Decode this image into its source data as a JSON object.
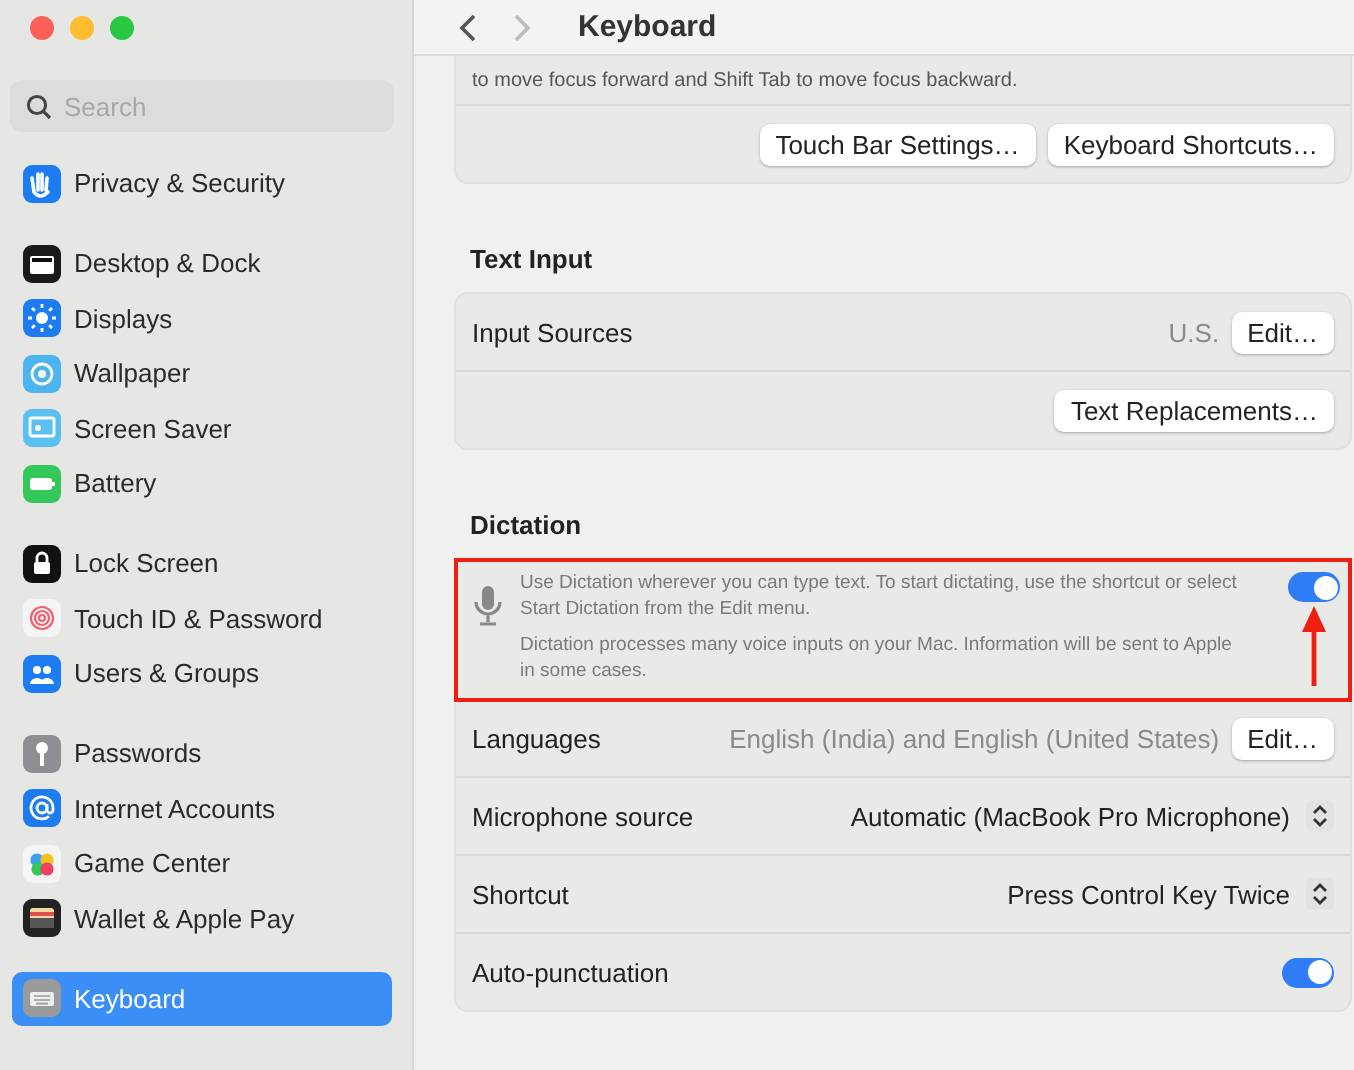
{
  "sidebar": {
    "search": {
      "placeholder": "Search"
    },
    "groups": [
      [
        {
          "label": "Privacy & Security",
          "selected": false
        }
      ],
      [
        {
          "label": "Desktop & Dock",
          "selected": false
        },
        {
          "label": "Displays",
          "selected": false
        },
        {
          "label": "Wallpaper",
          "selected": false
        },
        {
          "label": "Screen Saver",
          "selected": false
        },
        {
          "label": "Battery",
          "selected": false
        }
      ],
      [
        {
          "label": "Lock Screen",
          "selected": false
        },
        {
          "label": "Touch ID & Password",
          "selected": false
        },
        {
          "label": "Users & Groups",
          "selected": false
        }
      ],
      [
        {
          "label": "Passwords",
          "selected": false
        },
        {
          "label": "Internet Accounts",
          "selected": false
        },
        {
          "label": "Game Center",
          "selected": false
        },
        {
          "label": "Wallet & Apple Pay",
          "selected": false
        }
      ],
      [
        {
          "label": "Keyboard",
          "selected": true
        }
      ]
    ]
  },
  "content": {
    "title": "Keyboard",
    "top_card": {
      "text": "to move focus forward and Shift Tab to move focus backward.",
      "buttons": [
        "Touch Bar Settings…",
        "Keyboard Shortcuts…"
      ]
    },
    "sections": [
      {
        "heading": "Text Input",
        "rows": [
          {
            "kind": "value",
            "label": "Input Sources",
            "value": "U.S.",
            "button": "Edit…"
          },
          {
            "kind": "buttons",
            "buttons": [
              "Text Replacements…"
            ]
          }
        ]
      },
      {
        "heading": "Dictation",
        "rows": [
          {
            "kind": "info",
            "highlighted": true,
            "paragraphs": [
              "Use Dictation wherever you can type text. To start dictating, use the shortcut or select Start Dictation from the Edit menu.",
              "Dictation processes many voice inputs on your Mac. Information will be sent to Apple in some cases."
            ],
            "on": true
          },
          {
            "kind": "value",
            "label": "Languages",
            "value": "English (India) and English (United States)",
            "button": "Edit…"
          },
          {
            "kind": "popup",
            "label": "Microphone source",
            "value": "Automatic (MacBook Pro Microphone)"
          },
          {
            "kind": "popup",
            "label": "Shortcut",
            "value": "Press Control Key Twice"
          },
          {
            "kind": "toggle",
            "label": "Auto-punctuation",
            "on": true
          }
        ]
      }
    ]
  }
}
